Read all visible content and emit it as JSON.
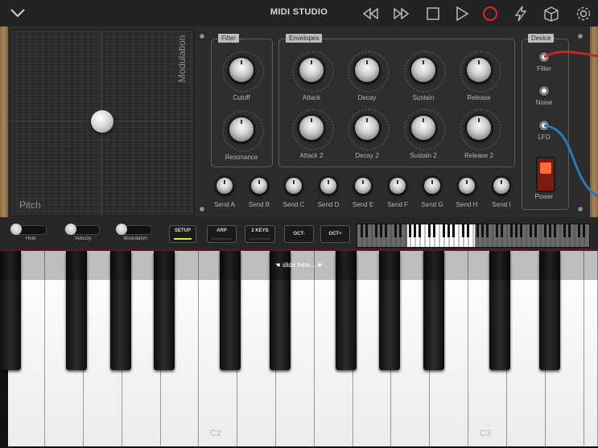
{
  "header": {
    "title": "MIDI STUDIO"
  },
  "icons": {
    "menu": "chevron-down-icon",
    "rewind": "rewind-icon",
    "forward": "fast-forward-icon",
    "stop": "stop-icon",
    "play": "play-icon",
    "record": "record-icon",
    "lightning": "lightning-icon",
    "instruments": "box-icon",
    "settings": "gear-icon"
  },
  "xypad": {
    "x_label": "Pitch",
    "y_label": "Modulation"
  },
  "filter": {
    "title": "Filter",
    "knobs": [
      "Cutoff",
      "Resonance"
    ]
  },
  "envelopes": {
    "title": "Envelopes",
    "knobs": [
      "Attack",
      "Decay",
      "Sustain",
      "Release",
      "Attack 2",
      "Decay 2",
      "Sustain 2",
      "Release 2"
    ]
  },
  "sends": [
    "Send A",
    "Send B",
    "Send C",
    "Send D",
    "Send E",
    "Send F",
    "Send G",
    "Send H",
    "Send I"
  ],
  "device": {
    "title": "Device",
    "jacks": [
      "Filter",
      "Noise",
      "LFO"
    ],
    "power_label": "Power"
  },
  "controls": {
    "sliders": [
      "Hold",
      "Velocity",
      "Modulation"
    ],
    "buttons": [
      "SETUP",
      "ARP",
      "2 KEYS",
      "OCT-",
      "OCT+"
    ]
  },
  "keyboard": {
    "hint": "☚ slide here... ☛",
    "octave_labels": [
      "C2",
      "C3"
    ]
  },
  "colors": {
    "accent": "#7a1010",
    "led_on": "#c8f04c",
    "record": "#e0302a",
    "cable_red": "#c0282a",
    "cable_blue": "#2a7ab0"
  }
}
